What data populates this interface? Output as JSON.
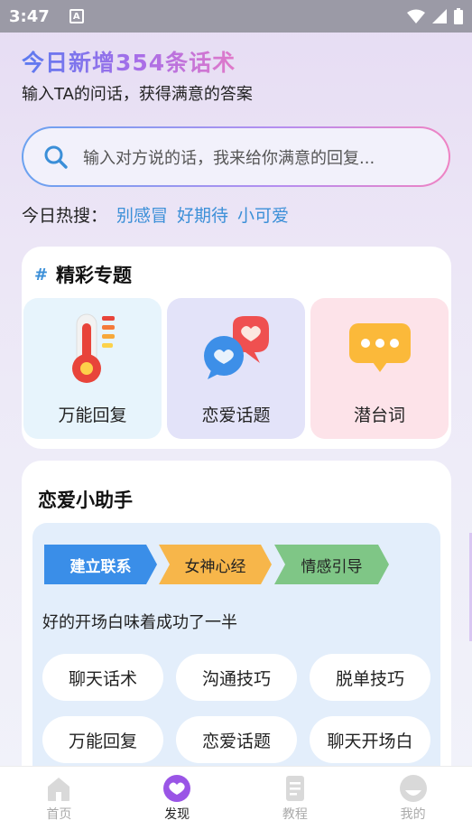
{
  "status_bar": {
    "time": "3:47",
    "notification_glyph": "A"
  },
  "header": {
    "headline": "今日新增354条话术",
    "subline": "输入TA的问话，获得满意的答案"
  },
  "search": {
    "placeholder": "输入对方说的话，我来给你满意的回复..."
  },
  "hot_search": {
    "label": "今日热搜：",
    "tags": [
      "别感冒",
      "好期待",
      "小可爱"
    ]
  },
  "featured": {
    "hash": "#",
    "title": "精彩专题",
    "tiles": [
      {
        "label": "万能回复",
        "icon": "thermometer-icon"
      },
      {
        "label": "恋爱话题",
        "icon": "chat-hearts-icon"
      },
      {
        "label": "潜台词",
        "icon": "speech-bubble-dots-icon"
      }
    ]
  },
  "love_helper": {
    "title": "恋爱小助手",
    "steps": [
      "建立联系",
      "女神心经",
      "情感引导"
    ],
    "tip": "好的开场白味着成功了一半",
    "pills": [
      "聊天话术",
      "沟通技巧",
      "脱单技巧",
      "万能回复",
      "恋爱话题",
      "聊天开场白"
    ]
  },
  "tab_bar": {
    "items": [
      {
        "label": "首页",
        "icon": "home-icon",
        "active": false
      },
      {
        "label": "发现",
        "icon": "discover-heart-icon",
        "active": true
      },
      {
        "label": "教程",
        "icon": "document-icon",
        "active": false
      },
      {
        "label": "我的",
        "icon": "profile-icon",
        "active": false
      }
    ]
  },
  "colors": {
    "accent_blue": "#3b8fd8",
    "step_blue": "#3a8ee8",
    "step_orange": "#f7b64a",
    "step_green": "#7fc686",
    "active_tab": "#9a55e6"
  }
}
